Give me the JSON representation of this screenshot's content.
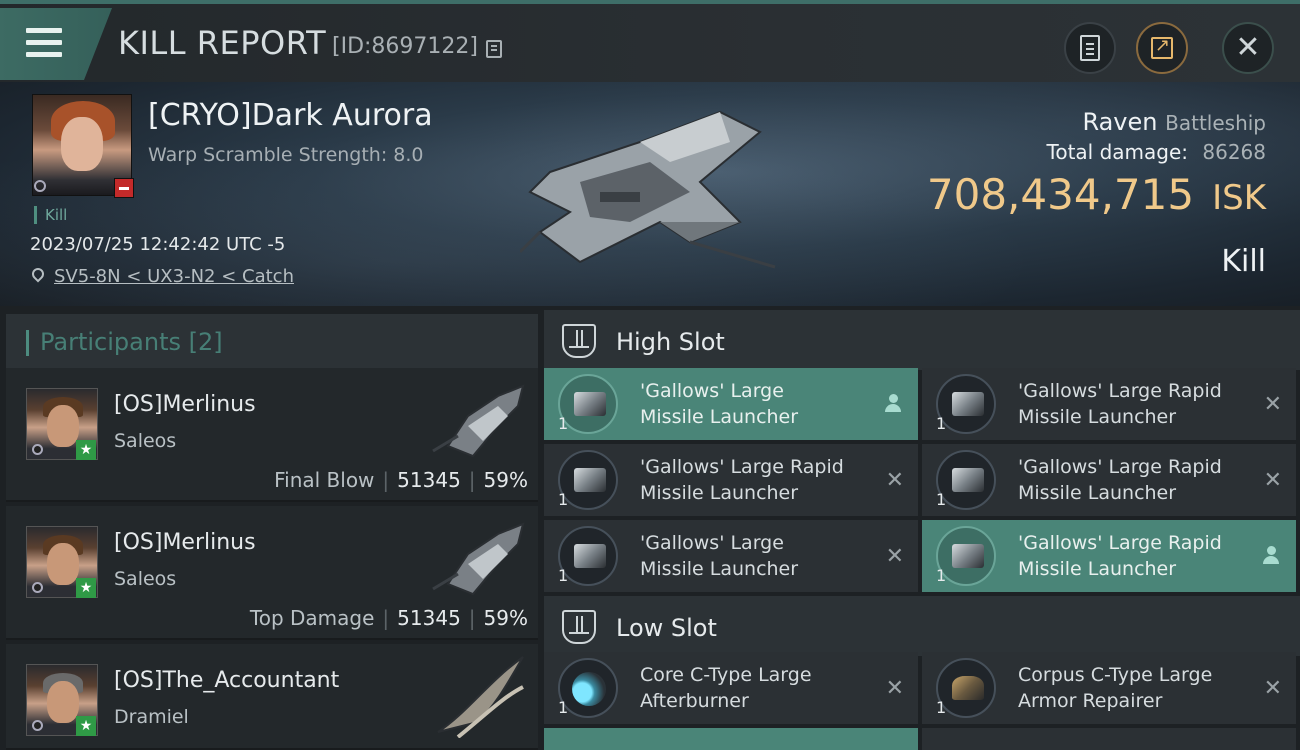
{
  "header": {
    "title": "KILL REPORT",
    "kill_id": "[ID:8697122]",
    "icons": [
      "menu-icon",
      "copy-icon",
      "clipboard-icon",
      "share-icon",
      "close-icon"
    ]
  },
  "victim": {
    "name": "[CRYO]Dark Aurora",
    "warp_scramble": "Warp Scramble Strength: 8.0",
    "tag": "Kill",
    "datetime": "2023/07/25 12:42:42 UTC -5",
    "location": "SV5-8N < UX3-N2 < Catch",
    "ship_name": "Raven",
    "ship_class": "Battleship",
    "total_damage_label": "Total damage:",
    "total_damage": "86268",
    "isk_value": "708,434,715",
    "isk_unit": "ISK",
    "result": "Kill"
  },
  "participants": {
    "header": "Participants [2]",
    "rows": [
      {
        "name": "[OS]Merlinus",
        "ship": "Saleos",
        "label": "Final Blow",
        "damage": "51345",
        "percent": "59%"
      },
      {
        "name": "[OS]Merlinus",
        "ship": "Saleos",
        "label": "Top Damage",
        "damage": "51345",
        "percent": "59%"
      },
      {
        "name": "[OS]The_Accountant",
        "ship": "Dramiel",
        "label": "",
        "damage": "",
        "percent": ""
      }
    ]
  },
  "high_slot": {
    "title": "High Slot",
    "items": [
      {
        "qty": "1",
        "line1": "'Gallows' Large",
        "line2": "Missile Launcher",
        "mark": "person"
      },
      {
        "qty": "1",
        "line1": "'Gallows' Large Rapid",
        "line2": "Missile Launcher",
        "mark": "x"
      },
      {
        "qty": "1",
        "line1": "'Gallows' Large Rapid",
        "line2": "Missile Launcher",
        "mark": "x"
      },
      {
        "qty": "1",
        "line1": "'Gallows' Large Rapid",
        "line2": "Missile Launcher",
        "mark": "x"
      },
      {
        "qty": "1",
        "line1": "'Gallows' Large",
        "line2": "Missile Launcher",
        "mark": "x"
      },
      {
        "qty": "1",
        "line1": "'Gallows' Large Rapid",
        "line2": "Missile Launcher",
        "mark": "person"
      }
    ]
  },
  "low_slot": {
    "title": "Low Slot",
    "items": [
      {
        "qty": "1",
        "line1": "Core C-Type Large",
        "line2": "Afterburner",
        "mark": "x"
      },
      {
        "qty": "1",
        "line1": "Corpus C-Type Large",
        "line2": "Armor Repairer",
        "mark": "x"
      }
    ]
  },
  "marks": {
    "x": "✕"
  },
  "colors": {
    "accent": "#4a8578",
    "isk": "#f0c98a",
    "badge_green": "#2f9a46",
    "badge_red": "#c32a2a"
  }
}
